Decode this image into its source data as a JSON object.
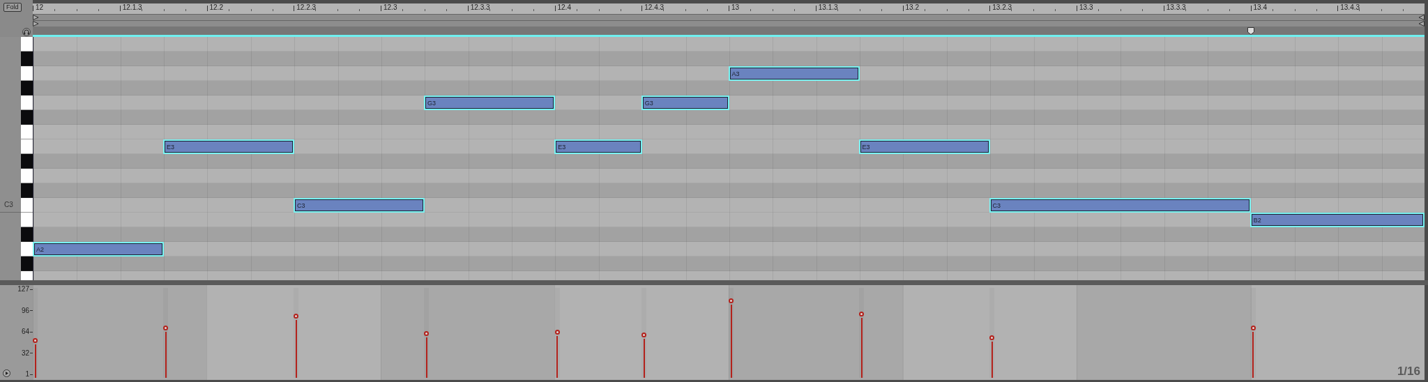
{
  "fold_button": "Fold",
  "ruler": [
    "12",
    "12.1.3",
    "12.2",
    "12.2.3",
    "12.3",
    "12.3.3",
    "12.4",
    "12.4.3",
    "13",
    "13.1.3",
    "13.2",
    "13.2.3",
    "13.3",
    "13.3.3",
    "13.4",
    "13.4.3"
  ],
  "lanes": [
    {
      "kind": "white"
    },
    {
      "kind": "black"
    },
    {
      "kind": "white",
      "notes": [
        {
          "label": "A3",
          "selected": true,
          "level": 0.86
        }
      ]
    },
    {
      "kind": "black"
    },
    {
      "kind": "white",
      "notes": [
        {
          "label": "G3",
          "selected": true,
          "level": 0.5
        },
        {
          "label": "G3",
          "selected": true,
          "level": 0.48
        }
      ]
    },
    {
      "kind": "black"
    },
    {
      "kind": "white"
    },
    {
      "kind": "white",
      "notes": [
        {
          "label": "E3",
          "selected": true,
          "level": 0.56
        },
        {
          "label": "E3",
          "selected": true,
          "level": 0.51
        },
        {
          "label": "E3",
          "selected": true,
          "level": 0.71
        }
      ]
    },
    {
      "kind": "black"
    },
    {
      "kind": "white"
    },
    {
      "kind": "black"
    },
    {
      "kind": "white",
      "label": "C3",
      "notes": [
        {
          "label": "C3",
          "selected": true,
          "level": 0.69
        },
        {
          "label": "C3",
          "selected": true,
          "level": 0.45
        }
      ]
    },
    {
      "kind": "white",
      "notes": [
        {
          "label": "B2",
          "selected": true,
          "level": 0.56
        }
      ]
    },
    {
      "kind": "black"
    },
    {
      "kind": "white",
      "notes": [
        {
          "label": "A2",
          "selected": true,
          "level": 0.42
        }
      ]
    },
    {
      "kind": "black"
    },
    {
      "kind": "white"
    }
  ],
  "velocity_axis": [
    "127",
    "96",
    "64",
    "32",
    "1"
  ],
  "grid_label": "1/16"
}
